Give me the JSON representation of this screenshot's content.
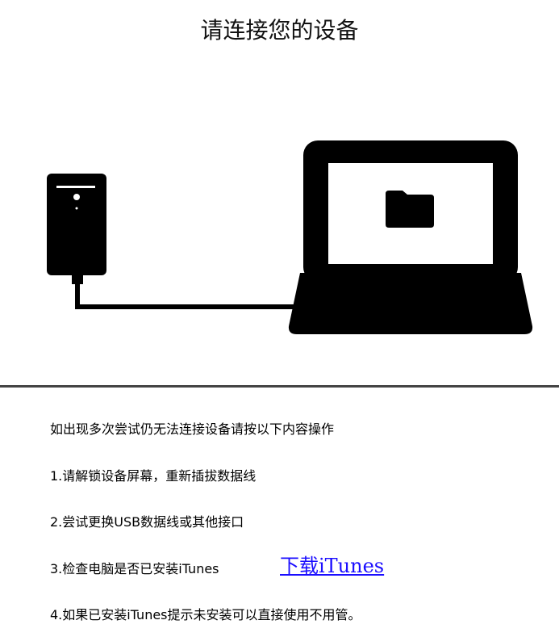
{
  "header": {
    "title": "请连接您的设备"
  },
  "illustration": {
    "phone_icon": "phone-icon",
    "laptop_icon": "laptop-icon",
    "folder_icon": "folder-icon",
    "cable_icon": "usb-cable-icon"
  },
  "instructions": {
    "intro": "如出现多次尝试仍无法连接设备请按以下内容操作",
    "step1": "1.请解锁设备屏幕，重新插拔数据线",
    "step2": "2.尝试更换USB数据线或其他接口",
    "step3": "3.检查电脑是否已安装iTunes",
    "step3_link": "下载iTunes",
    "step4": "4.如果已安装iTunes提示未安装可以直接使用不用管。"
  },
  "colors": {
    "link": "#1a0dff",
    "divider": "#444444",
    "illustration": "#000000"
  }
}
